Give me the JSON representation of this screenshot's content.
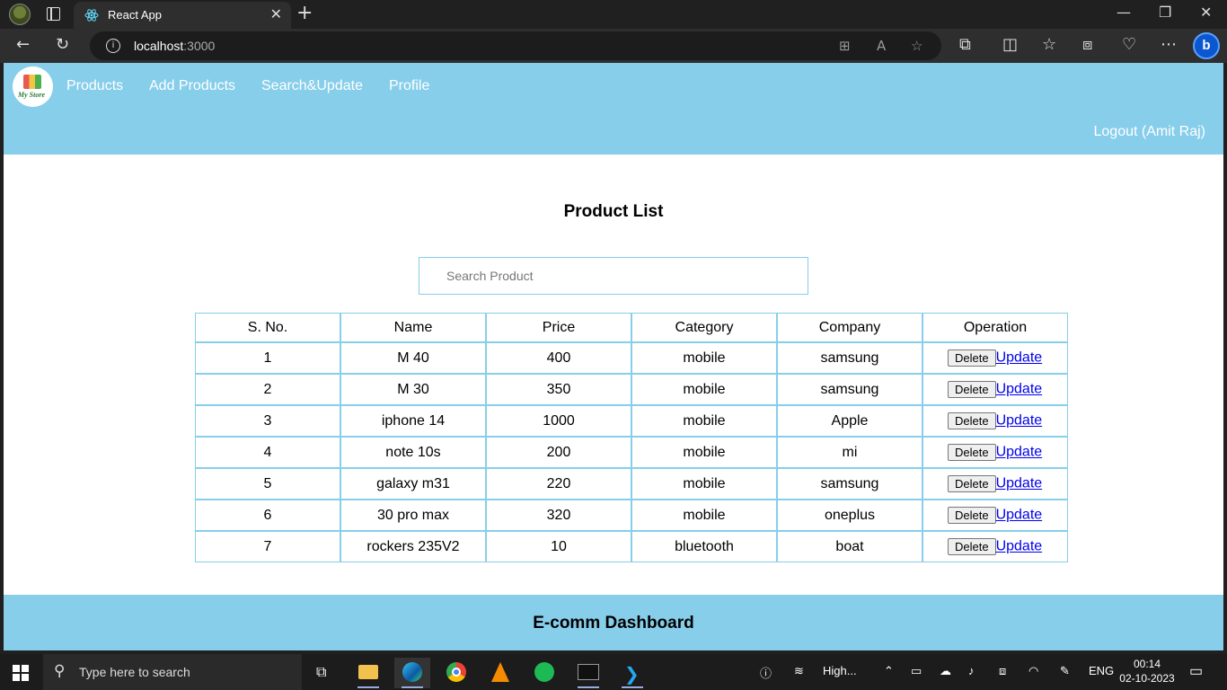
{
  "browser": {
    "tab_title": "React App",
    "url_host": "localhost",
    "url_port": ":3000"
  },
  "nav": {
    "items": [
      "Products",
      "Add Products",
      "Search&Update",
      "Profile"
    ],
    "logout": "Logout (Amit Raj)",
    "logo_text": "My Store"
  },
  "main": {
    "title": "Product List",
    "search_placeholder": "Search Product",
    "columns": [
      "S. No.",
      "Name",
      "Price",
      "Category",
      "Company",
      "Operation"
    ],
    "delete_label": "Delete",
    "update_label": "Update",
    "rows": [
      [
        "1",
        "M 40",
        "400",
        "mobile",
        "samsung"
      ],
      [
        "2",
        "M 30",
        "350",
        "mobile",
        "samsung"
      ],
      [
        "3",
        "iphone 14",
        "1000",
        "mobile",
        "Apple"
      ],
      [
        "4",
        "note 10s",
        "200",
        "mobile",
        "mi"
      ],
      [
        "5",
        "galaxy m31",
        "220",
        "mobile",
        "samsung"
      ],
      [
        "6",
        "30 pro max",
        "320",
        "mobile",
        "oneplus"
      ],
      [
        "7",
        "rockers 235V2",
        "10",
        "bluetooth",
        "boat"
      ]
    ]
  },
  "footer": {
    "title": "E-comm Dashboard"
  },
  "taskbar": {
    "search_placeholder": "Type here to search",
    "weather": "High...",
    "lang": "ENG",
    "time": "00:14",
    "date": "02-10-2023"
  },
  "colors": {
    "accent": "#87ceeb",
    "link": "#0000ee"
  }
}
